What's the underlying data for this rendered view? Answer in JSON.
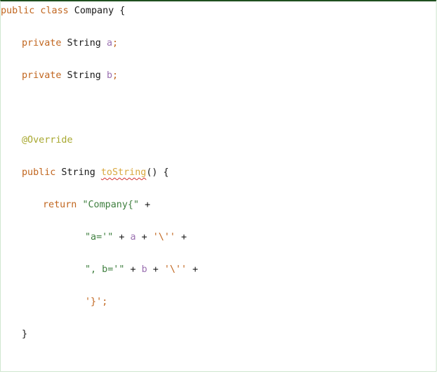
{
  "code": {
    "line1": {
      "kw1": "public class",
      "name": " Company {"
    },
    "line2": {
      "kw": "private",
      "type": " String ",
      "field": "a",
      "semi": ";"
    },
    "line3": {
      "kw": "private",
      "type": " String ",
      "field": "b",
      "semi": ";"
    },
    "line4": {
      "annotation": "@Override"
    },
    "line5": {
      "kw": "public",
      "type": " String ",
      "method": "toString",
      "rest": "() {"
    },
    "line6": {
      "kw": "return",
      "space": " ",
      "str": "\"Company{\"",
      "plus": " +"
    },
    "line7": {
      "str1": "\"a='\"",
      "op1": " + ",
      "field": "a",
      "op2": " + ",
      "str2": "'\\''",
      "op3": " +"
    },
    "line8": {
      "str1": "\", b='\"",
      "op1": " + ",
      "field": "b",
      "op2": " + ",
      "str2": "'\\''",
      "op3": " +"
    },
    "line9": {
      "str": "'}'",
      "semi": ";"
    },
    "line10": {
      "brace": "}"
    }
  }
}
